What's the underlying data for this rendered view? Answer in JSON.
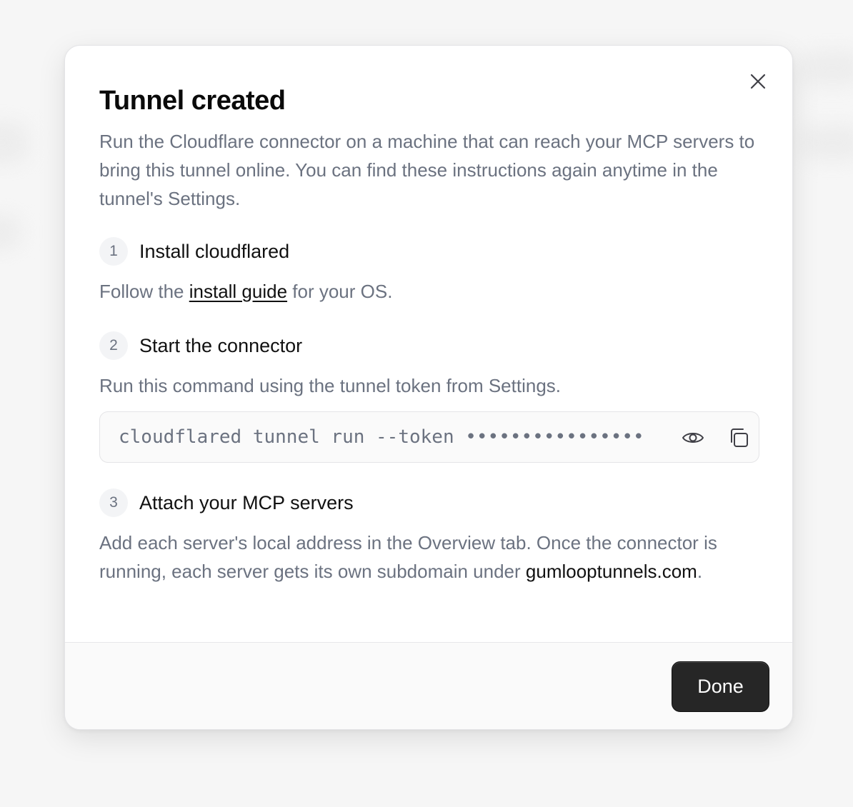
{
  "dialog": {
    "title": "Tunnel created",
    "description": "Run the Cloudflare connector on a machine that can reach your MCP servers to bring this tunnel online. You can find these instructions again anytime in the tunnel's Settings.",
    "close_icon": "close-icon"
  },
  "steps": [
    {
      "number": "1",
      "title": "Install cloudflared",
      "text_before": "Follow the ",
      "link": "install guide",
      "text_after": " for your OS."
    },
    {
      "number": "2",
      "title": "Start the connector",
      "text": "Run this command using the tunnel token from Settings.",
      "command": "cloudflared tunnel run --token ••••••••••••••••",
      "reveal_icon": "eye-icon",
      "copy_icon": "copy-icon"
    },
    {
      "number": "3",
      "title": "Attach your MCP servers",
      "text": "Add each server's local address in the Overview tab. Once the connector is running, each server gets its own subdomain under ",
      "domain": "gumlooptunnels.com",
      "text_after": "."
    }
  ],
  "footer": {
    "done_label": "Done"
  }
}
